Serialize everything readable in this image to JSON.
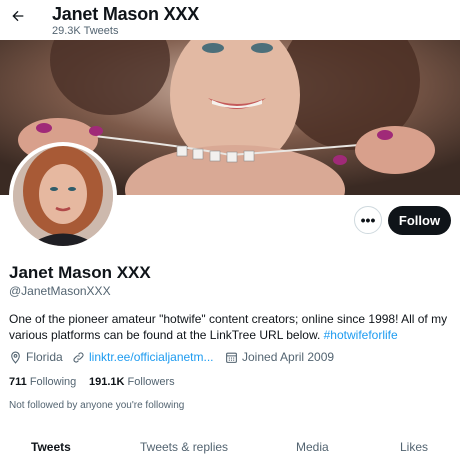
{
  "header": {
    "title": "Janet Mason XXX",
    "tweet_count": "29.3K Tweets"
  },
  "icons": {
    "back": "arrow-left-icon",
    "more": "more-icon",
    "location": "location-pin-icon",
    "link": "link-icon",
    "calendar": "calendar-icon"
  },
  "actions": {
    "more_label": "•••",
    "follow_label": "Follow"
  },
  "profile": {
    "name": "Janet Mason XXX",
    "handle": "@JanetMasonXXX",
    "bio_text": "One of the pioneer amateur \"hotwife\" content creators; online since 1998! All of my various platforms can be found at the LinkTree URL below. ",
    "bio_hashtag": "#hotwifeforlife",
    "location": "Florida",
    "website": "linktr.ee/officialjanetm...",
    "joined": "Joined April 2009",
    "following_count": "711",
    "following_label": "Following",
    "followers_count": "191.1K",
    "followers_label": "Followers",
    "not_followed_note": "Not followed by anyone you're following"
  },
  "tabs": [
    {
      "label": "Tweets",
      "active": true
    },
    {
      "label": "Tweets & replies",
      "active": false
    },
    {
      "label": "Media",
      "active": false
    },
    {
      "label": "Likes",
      "active": false
    }
  ],
  "colors": {
    "accent": "#1d9bf0",
    "text_primary": "#0f1419",
    "text_secondary": "#536471",
    "follow_button": "#0f1419"
  }
}
